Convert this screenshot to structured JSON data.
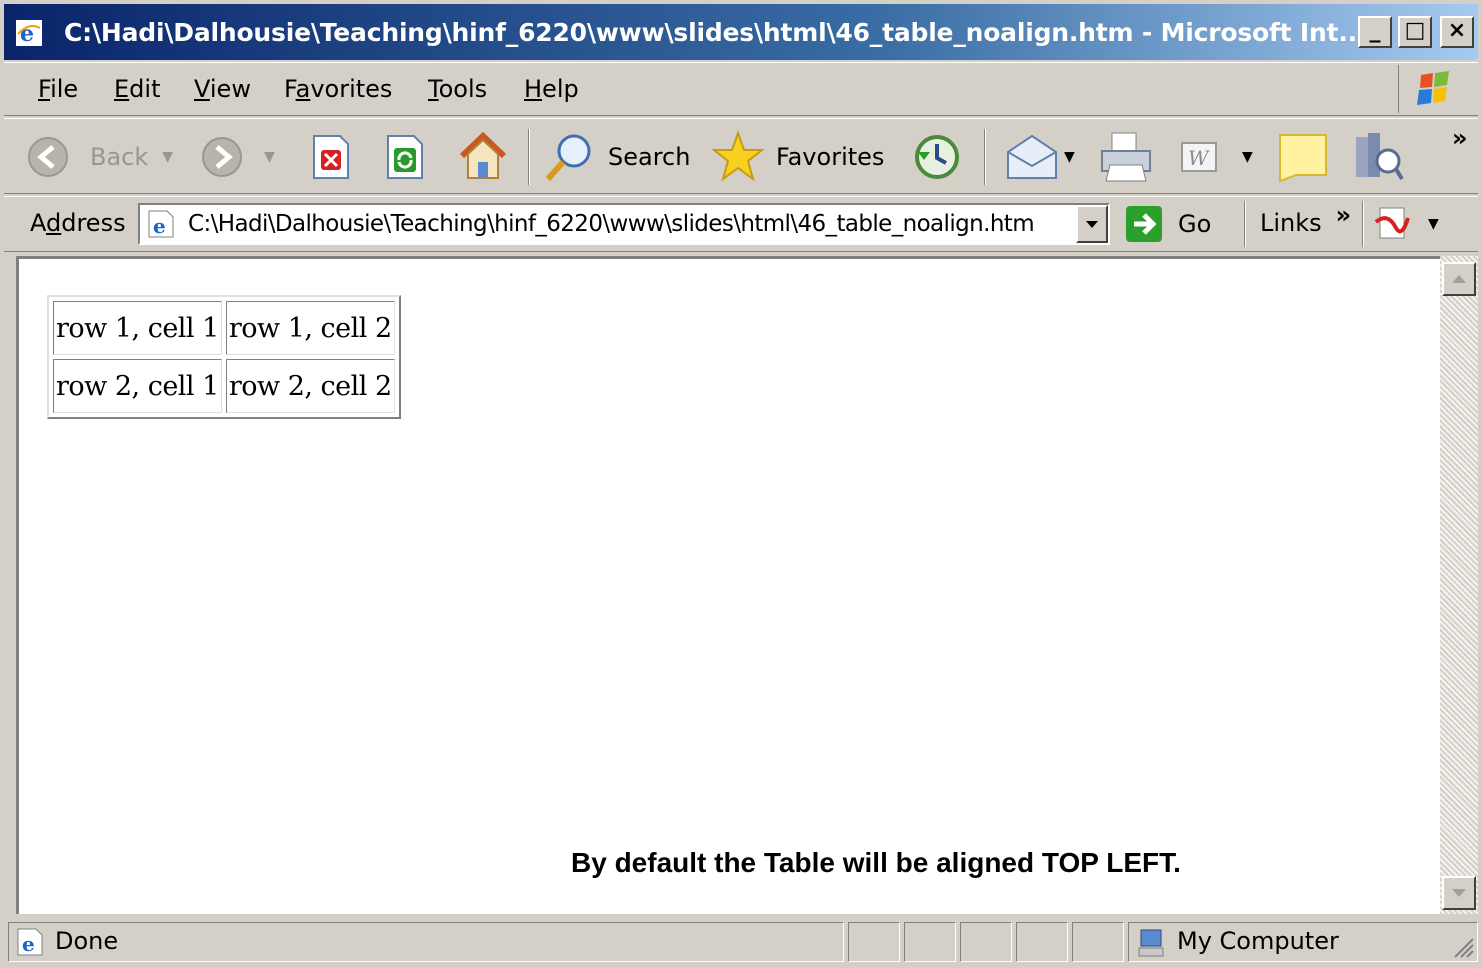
{
  "window": {
    "title": "C:\\Hadi\\Dalhousie\\Teaching\\hinf_6220\\www\\slides\\html\\46_table_noalign.htm - Microsoft Int...",
    "minimize_label": "_",
    "maximize_label": "□",
    "close_label": "×"
  },
  "menu": {
    "items": [
      {
        "accel": "F",
        "rest": "ile"
      },
      {
        "accel": "E",
        "rest": "dit"
      },
      {
        "accel": "V",
        "rest": "iew"
      },
      {
        "pre": "F",
        "accel": "a",
        "rest": "vorites"
      },
      {
        "accel": "T",
        "rest": "ools"
      },
      {
        "accel": "H",
        "rest": "elp"
      }
    ]
  },
  "toolbar": {
    "back_label": "Back",
    "search_label": "Search",
    "favorites_label": "Favorites",
    "chevron": "»",
    "icons": [
      "back-icon",
      "forward-icon",
      "stop-icon",
      "refresh-icon",
      "home-icon",
      "search-icon",
      "favorites-icon",
      "history-icon",
      "mail-icon",
      "print-icon",
      "edit-word-icon",
      "discuss-icon",
      "research-icon"
    ]
  },
  "address": {
    "label_pre": "A",
    "label_accel": "d",
    "label_rest": "dress",
    "value": "C:\\Hadi\\Dalhousie\\Teaching\\hinf_6220\\www\\slides\\html\\46_table_noalign.htm",
    "go_label": "Go",
    "links_label": "Links",
    "links_chevron": "»"
  },
  "page": {
    "table": [
      [
        "row 1, cell 1",
        "row 1, cell 2"
      ],
      [
        "row 2, cell 1",
        "row 2, cell 2"
      ]
    ],
    "caption": "By default the Table will be aligned TOP LEFT."
  },
  "status": {
    "text": "Done",
    "zone": "My Computer"
  },
  "colors": {
    "title_start": "#0a246a",
    "title_end": "#a6caf0",
    "chrome": "#d4d0c8"
  }
}
